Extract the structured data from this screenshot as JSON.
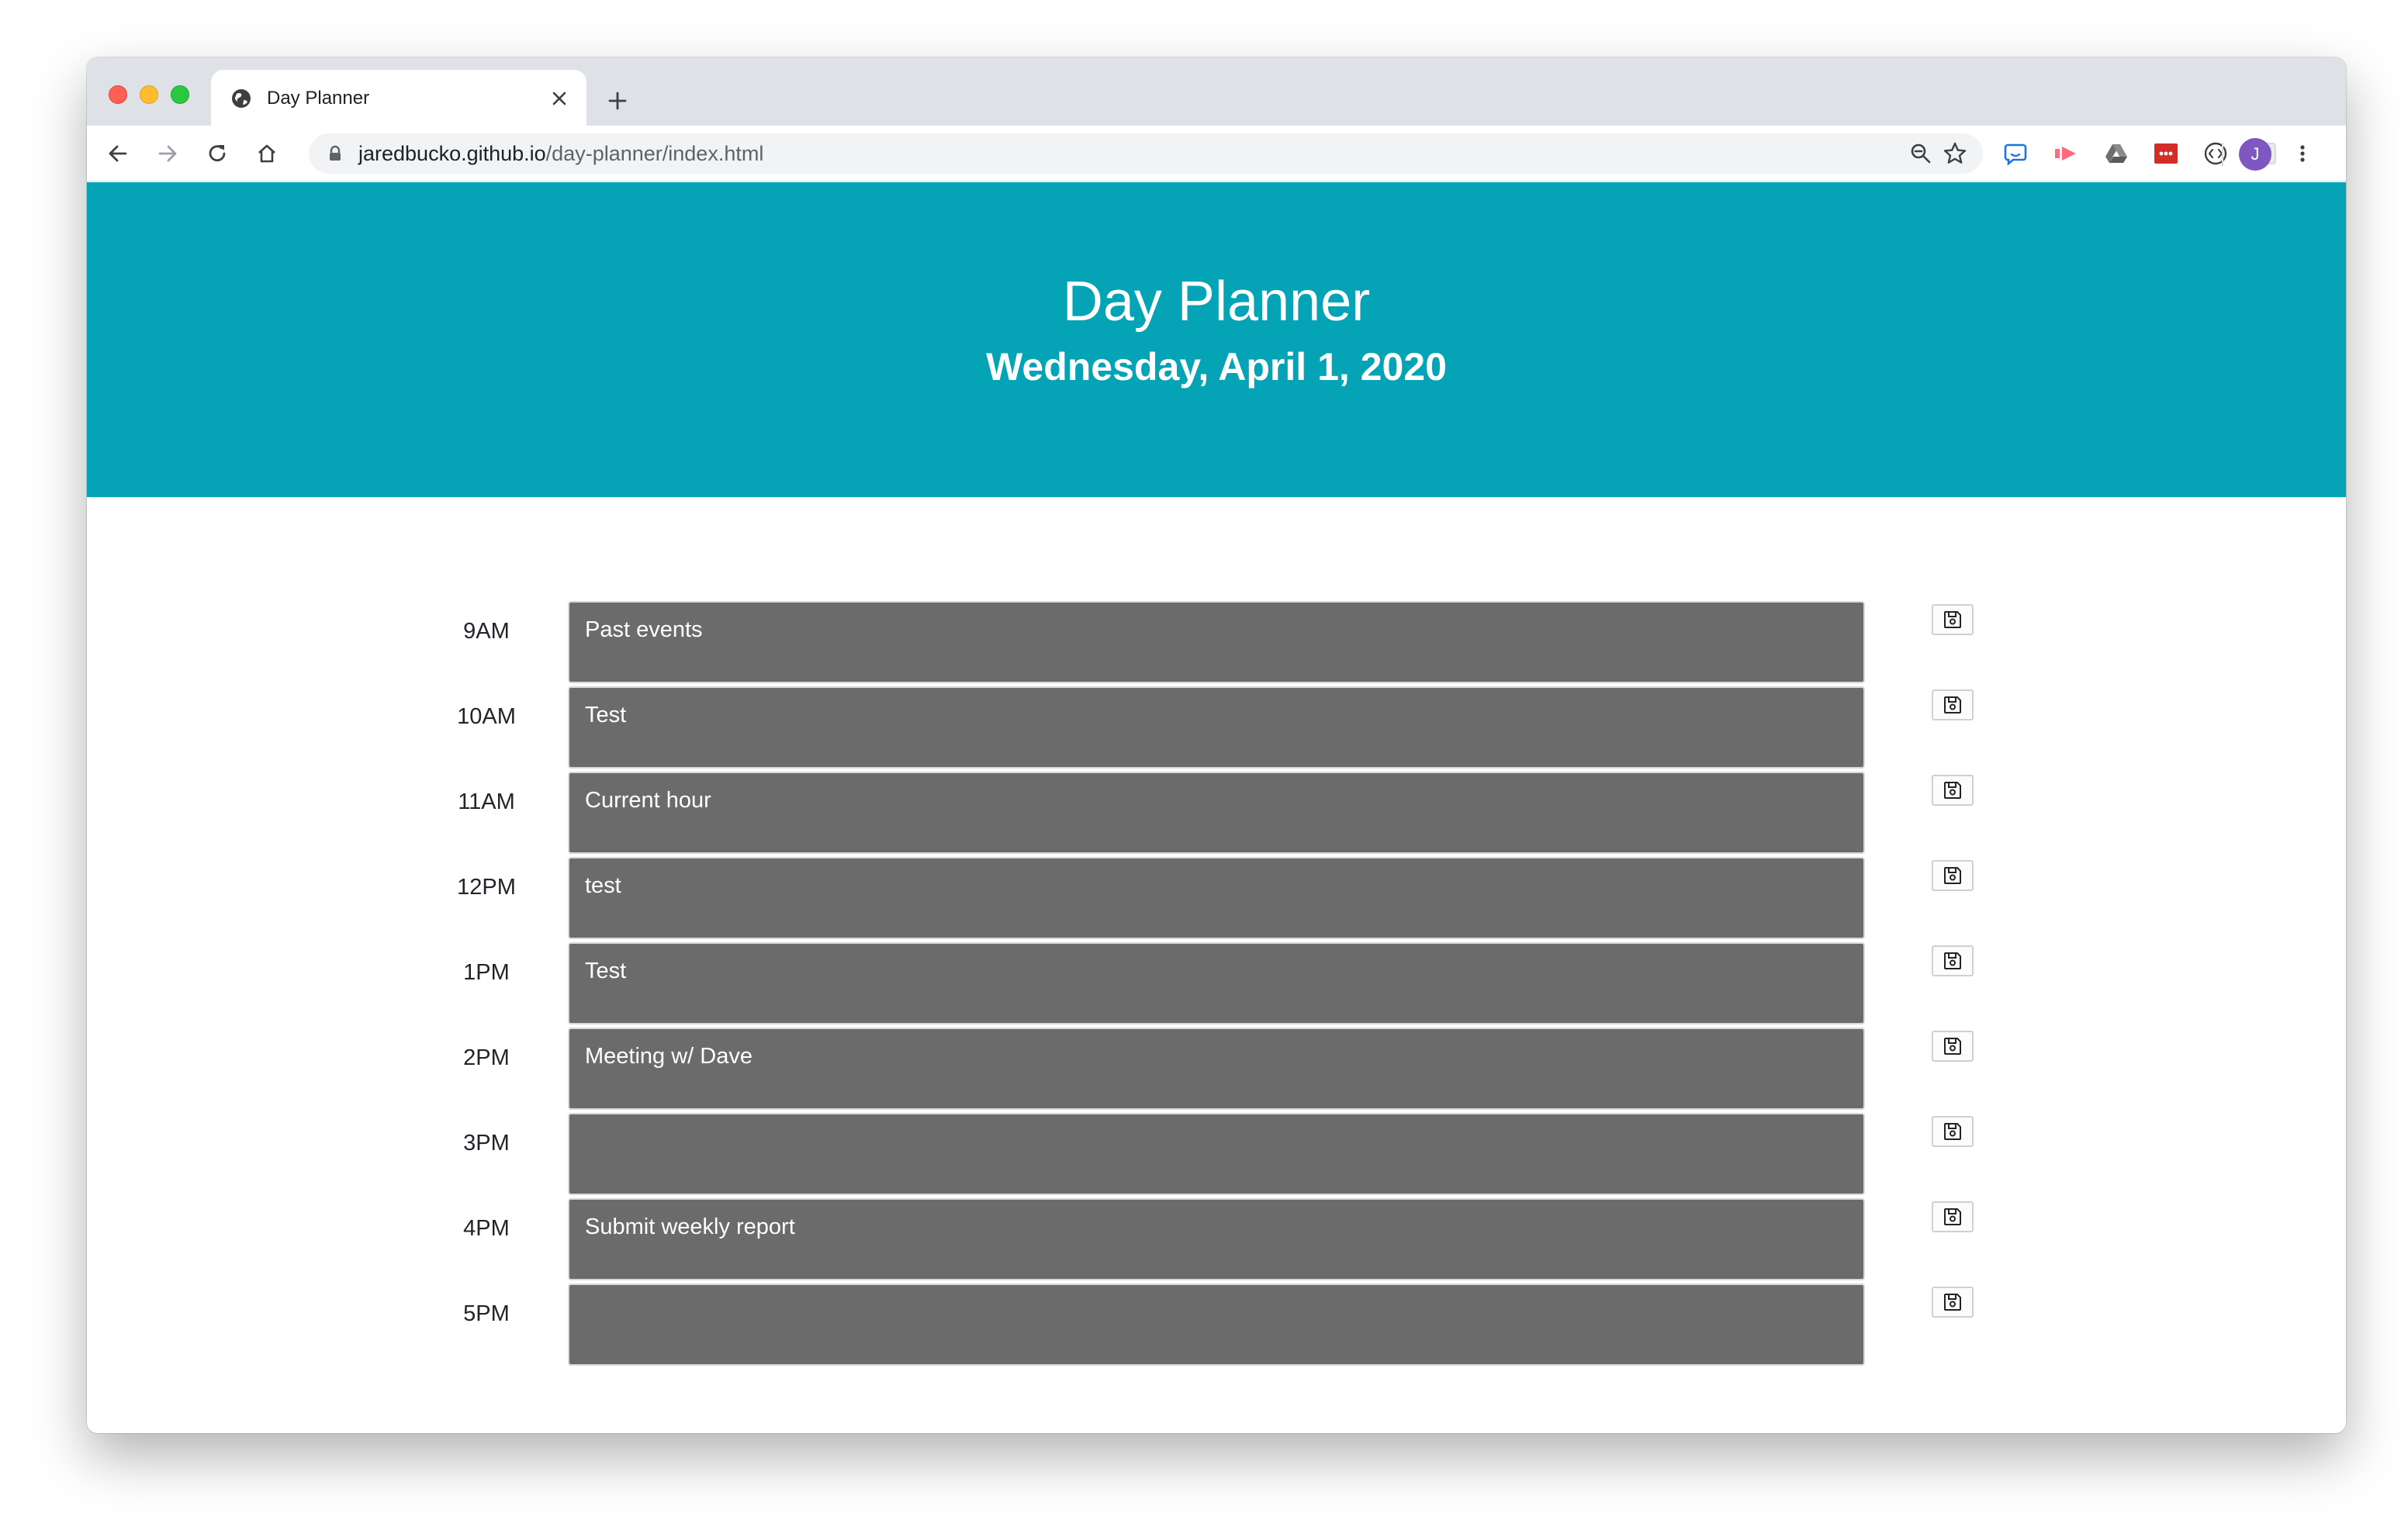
{
  "browser": {
    "tab_title": "Day Planner",
    "url_host": "jaredbucko.github.io",
    "url_path": "/day-planner/index.html",
    "avatar_initial": "J",
    "icons": {
      "favicon": "globe-icon",
      "close": "close-icon",
      "new_tab": "plus-icon",
      "back": "back-arrow-icon",
      "forward": "forward-arrow-icon",
      "reload": "reload-icon",
      "home": "home-icon",
      "lock": "lock-icon",
      "zoom": "zoom-out-icon",
      "bookmark": "star-icon",
      "menu": "kebab-menu-icon"
    },
    "extensions": [
      "chat-extension-icon",
      "video-extension-icon",
      "drive-extension-icon",
      "lastpass-extension-icon",
      "code-extension-icon",
      "grid-extension-icon"
    ]
  },
  "header": {
    "title": "Day Planner",
    "date": "Wednesday, April 1, 2020"
  },
  "planner": {
    "rows": [
      {
        "hour": "9AM",
        "text": "Past events"
      },
      {
        "hour": "10AM",
        "text": "Test"
      },
      {
        "hour": "11AM",
        "text": "Current hour"
      },
      {
        "hour": "12PM",
        "text": "test"
      },
      {
        "hour": "1PM",
        "text": "Test"
      },
      {
        "hour": "2PM",
        "text": "Meeting w/ Dave"
      },
      {
        "hour": "3PM",
        "text": ""
      },
      {
        "hour": "4PM",
        "text": "Submit weekly report"
      },
      {
        "hour": "5PM",
        "text": ""
      }
    ],
    "save_icon": "save-icon"
  },
  "colors": {
    "header_bg": "#04a3b6",
    "event_bg": "#6b6b6b",
    "avatar_bg": "#7e57c2"
  }
}
